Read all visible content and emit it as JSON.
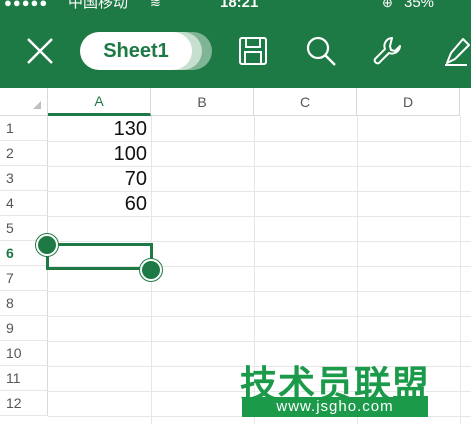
{
  "status_bar": {
    "signal": "●●●●●",
    "carrier": "中国移动",
    "wifi": "≋",
    "time": "18:21",
    "lock_icon": "lock-rotation-icon",
    "battery": "35%"
  },
  "toolbar": {
    "sheet_tab": "Sheet1",
    "icons": [
      "close-icon",
      "save-icon",
      "search-icon",
      "wrench-icon",
      "draw-icon"
    ]
  },
  "grid": {
    "columns": [
      "A",
      "B",
      "C",
      "D"
    ],
    "rows": [
      "1",
      "2",
      "3",
      "4",
      "5",
      "6",
      "7",
      "8",
      "9",
      "10",
      "11",
      "12"
    ],
    "cells_a": [
      "130",
      "100",
      "70",
      "60"
    ],
    "active_row": "6",
    "active_column": "A"
  },
  "watermark": {
    "title": "技术员联盟",
    "url": "www.jsgho.com"
  },
  "colors": {
    "brand": "#1e7a45",
    "watermark": "#1b9a4a",
    "grid_line": "#e6e6e6"
  }
}
